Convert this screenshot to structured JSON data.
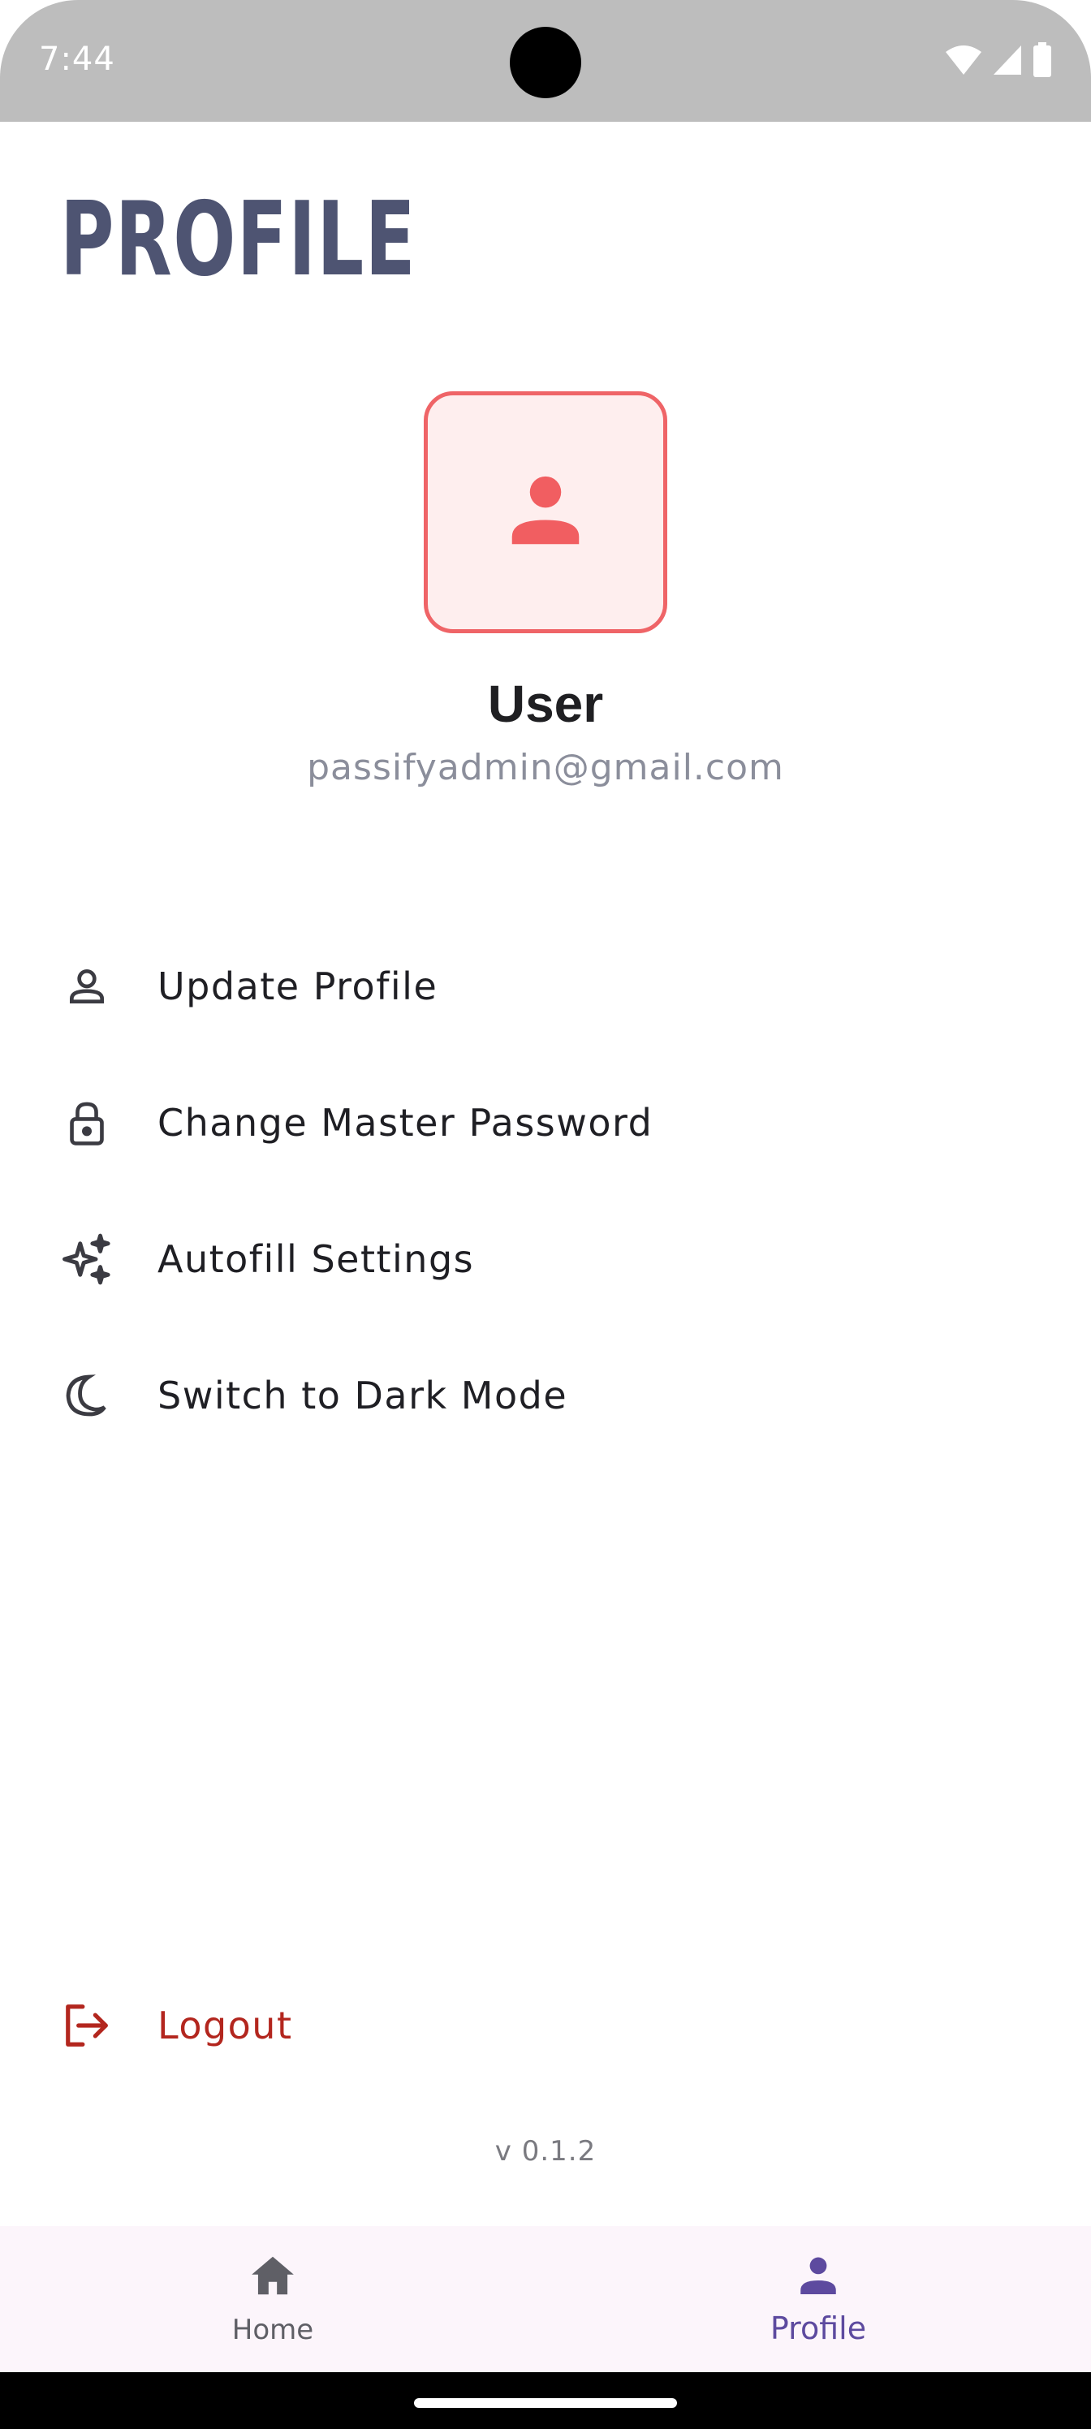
{
  "status_bar": {
    "time": "7:44",
    "icons": [
      "wifi-icon",
      "signal-icon",
      "battery-icon"
    ]
  },
  "page": {
    "title": "PROFILE"
  },
  "profile": {
    "avatar_icon": "person-icon",
    "name": "User",
    "email": "passifyadmin@gmail.com"
  },
  "menu": {
    "items": [
      {
        "label": "Update Profile",
        "icon": "person-outline-icon"
      },
      {
        "label": "Change Master Password",
        "icon": "lock-icon"
      },
      {
        "label": "Autofill Settings",
        "icon": "sparkle-icon"
      },
      {
        "label": "Switch to Dark Mode",
        "icon": "moon-icon"
      }
    ],
    "logout": {
      "label": "Logout",
      "icon": "logout-icon"
    }
  },
  "version": "v 0.1.2",
  "bottom_nav": {
    "items": [
      {
        "label": "Home",
        "icon": "home-icon",
        "active": false
      },
      {
        "label": "Profile",
        "icon": "person-icon",
        "active": true
      }
    ]
  },
  "colors": {
    "title": "#4e5472",
    "accent_red": "#ef6467",
    "logout_red": "#b3261e",
    "nav_active": "#5d4a9f"
  }
}
